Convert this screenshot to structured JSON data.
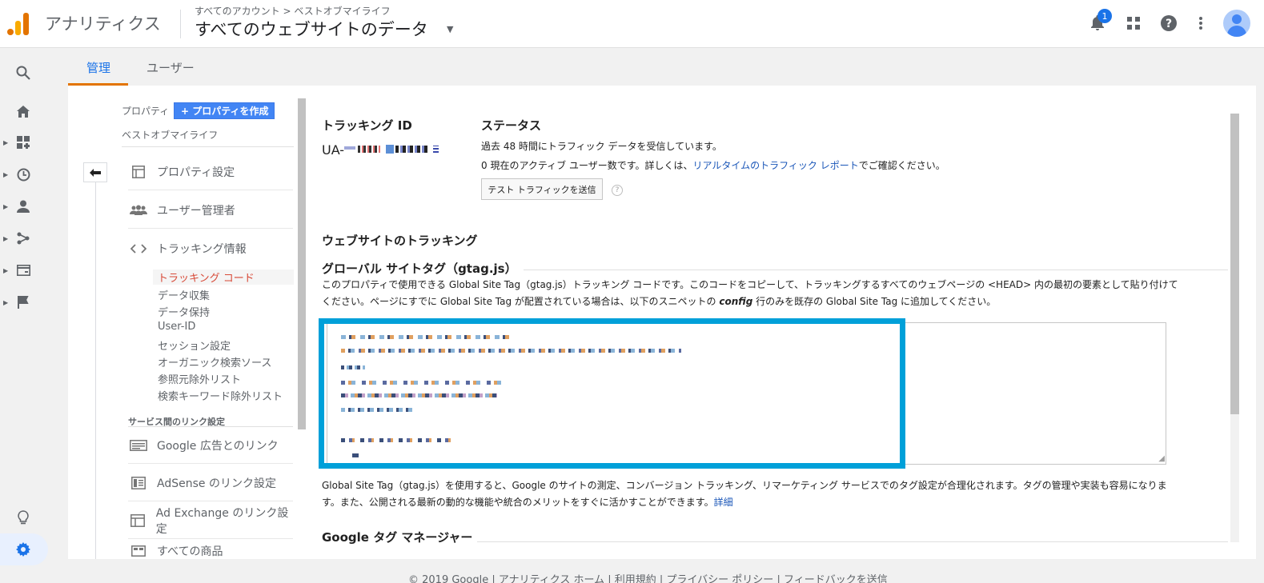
{
  "header": {
    "app_title": "アナリティクス",
    "breadcrumb": "すべてのアカウント > ベストオブマイライフ",
    "view_name": "すべてのウェブサイトのデータ",
    "notification_count": "1"
  },
  "tabs": [
    {
      "label": "管理",
      "active": true
    },
    {
      "label": "ユーザー",
      "active": false
    }
  ],
  "property_column": {
    "label": "プロパティ",
    "create_button": "+ プロパティを作成",
    "property_name": "ベストオブマイライフ",
    "menu": [
      {
        "label": "プロパティ設定",
        "icon": "layout-icon"
      },
      {
        "label": "ユーザー管理者",
        "icon": "people-icon"
      },
      {
        "label": "トラッキング情報",
        "icon": "code-icon"
      }
    ],
    "tracking_sub": [
      "トラッキング コード",
      "データ収集",
      "データ保持",
      "User-ID",
      "セッション設定",
      "オーガニック検索ソース",
      "参照元除外リスト",
      "検索キーワード除外リスト"
    ],
    "section_label": "サービス間のリンク設定",
    "link_menu": [
      {
        "label": "Google 広告とのリンク",
        "icon": "ads-icon"
      },
      {
        "label": "AdSense のリンク設定",
        "icon": "adsense-icon"
      },
      {
        "label": "Ad Exchange のリンク設定",
        "icon": "adx-icon"
      },
      {
        "label": "すべての商品",
        "icon": "products-icon"
      }
    ]
  },
  "tracking": {
    "id_title": "トラッキング ID",
    "id_value": "UA-",
    "status_title": "ステータス",
    "status_line1": "過去 48 時間にトラフィック データを受信しています。",
    "status_line2_pre": "0 現在のアクティブ ユーザー数です。詳しくは、",
    "status_line2_link": "リアルタイムのトラフィック レポート",
    "status_line2_post": "でご確認ください。",
    "test_button": "テスト トラフィックを送信",
    "website_tracking_title": "ウェブサイトのトラッキング",
    "gtag_title": "グローバル サイトタグ（gtag.js）",
    "gtag_desc_line1": "このプロパティで使用できる Global Site Tag（gtag.js）トラッキング コードです。このコードをコピーして、トラッキングするすべてのウェブページの <HEAD> 内の最初の要素として貼り付けて",
    "gtag_desc_line2_pre": "ください。ページにすでに Global Site Tag が配置されている場合は、以下のスニペットの ",
    "gtag_desc_line2_em": "config",
    "gtag_desc_line2_post": " 行のみを既存の Global Site Tag に追加してください。",
    "info_line1": "Global Site Tag（gtag.js）を使用すると、Google のサイトの測定、コンバージョン トラッキング、リマーケティング サービスでのタグ設定が合理化されます。タグの管理や実装も容易になりま",
    "info_line2_pre": "す。また、公開される最新の動的な機能や統合のメリットをすぐに活かすことができます。",
    "info_link": "詳細",
    "gtm_title": "Google タグ マネージャー"
  },
  "footer": "© 2019 Google | アナリティクス ホーム | 利用規約 | プライバシー ポリシー | フィードバックを送信",
  "colors": {
    "accent_orange": "#e37400",
    "primary_blue": "#4285f4",
    "highlight_cyan": "#00a0d9",
    "active_red": "#d84a38"
  }
}
